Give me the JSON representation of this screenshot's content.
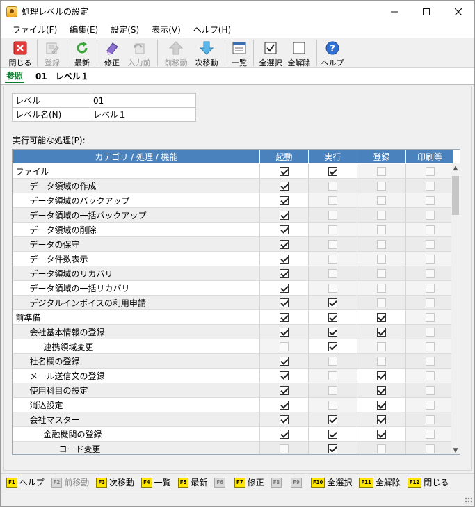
{
  "window": {
    "title": "処理レベルの設定"
  },
  "menu": [
    "ファイル(F)",
    "編集(E)",
    "設定(S)",
    "表示(V)",
    "ヘルプ(H)"
  ],
  "toolbar": [
    {
      "label": "閉じる",
      "icon": "close-icon",
      "disabled": false
    },
    {
      "label": "登録",
      "icon": "register-icon",
      "disabled": true
    },
    {
      "label": "最新",
      "icon": "refresh-icon",
      "disabled": false
    },
    {
      "label": "修正",
      "icon": "edit-icon",
      "disabled": false
    },
    {
      "label": "入力前",
      "icon": "undo-icon",
      "disabled": true
    },
    {
      "label": "前移動",
      "icon": "arrow-up-icon",
      "disabled": true
    },
    {
      "label": "次移動",
      "icon": "arrow-down-icon",
      "disabled": false
    },
    {
      "label": "一覧",
      "icon": "list-icon",
      "disabled": false
    },
    {
      "label": "全選択",
      "icon": "select-all-icon",
      "disabled": false
    },
    {
      "label": "全解除",
      "icon": "deselect-all-icon",
      "disabled": false
    },
    {
      "label": "ヘルプ",
      "icon": "help-icon",
      "disabled": false
    }
  ],
  "tab": {
    "label": "参照",
    "level_title": "01　レベル１"
  },
  "fields": {
    "level_label": "レベル",
    "level_value": "01",
    "level_name_label": "レベル名(N)",
    "level_name_value": "レベル１"
  },
  "section_label": "実行可能な処理(P):",
  "grid": {
    "columns": [
      "カテゴリ / 処理 / 機能",
      "起動",
      "実行",
      "登録",
      "印刷等"
    ],
    "rows": [
      {
        "name": "ファイル",
        "indent": 0,
        "c": [
          1,
          1,
          0,
          0
        ],
        "e": [
          1,
          1,
          0,
          0
        ]
      },
      {
        "name": "データ領域の作成",
        "indent": 1,
        "c": [
          1,
          0,
          0,
          0
        ],
        "e": [
          1,
          0,
          0,
          0
        ]
      },
      {
        "name": "データ領域のバックアップ",
        "indent": 1,
        "c": [
          1,
          0,
          0,
          0
        ],
        "e": [
          1,
          0,
          0,
          0
        ]
      },
      {
        "name": "データ領域の一括バックアップ",
        "indent": 1,
        "c": [
          1,
          0,
          0,
          0
        ],
        "e": [
          1,
          0,
          0,
          0
        ]
      },
      {
        "name": "データ領域の削除",
        "indent": 1,
        "c": [
          1,
          0,
          0,
          0
        ],
        "e": [
          1,
          0,
          0,
          0
        ]
      },
      {
        "name": "データの保守",
        "indent": 1,
        "c": [
          1,
          0,
          0,
          0
        ],
        "e": [
          1,
          0,
          0,
          0
        ]
      },
      {
        "name": "データ件数表示",
        "indent": 1,
        "c": [
          1,
          0,
          0,
          0
        ],
        "e": [
          1,
          0,
          0,
          0
        ]
      },
      {
        "name": "データ領域のリカバリ",
        "indent": 1,
        "c": [
          1,
          0,
          0,
          0
        ],
        "e": [
          1,
          0,
          0,
          0
        ]
      },
      {
        "name": "データ領域の一括リカバリ",
        "indent": 1,
        "c": [
          1,
          0,
          0,
          0
        ],
        "e": [
          1,
          0,
          0,
          0
        ]
      },
      {
        "name": "デジタルインボイスの利用申請",
        "indent": 1,
        "c": [
          1,
          1,
          0,
          0
        ],
        "e": [
          1,
          1,
          0,
          0
        ]
      },
      {
        "name": "前準備",
        "indent": 0,
        "c": [
          1,
          1,
          1,
          0
        ],
        "e": [
          1,
          1,
          1,
          0
        ]
      },
      {
        "name": "会社基本情報の登録",
        "indent": 1,
        "c": [
          1,
          1,
          1,
          0
        ],
        "e": [
          1,
          1,
          1,
          0
        ]
      },
      {
        "name": "連携領域変更",
        "indent": 2,
        "c": [
          0,
          1,
          0,
          0
        ],
        "e": [
          0,
          1,
          0,
          0
        ]
      },
      {
        "name": "社名欄の登録",
        "indent": 1,
        "c": [
          1,
          0,
          0,
          0
        ],
        "e": [
          1,
          0,
          0,
          0
        ]
      },
      {
        "name": "メール送信文の登録",
        "indent": 1,
        "c": [
          1,
          0,
          1,
          0
        ],
        "e": [
          1,
          0,
          1,
          0
        ]
      },
      {
        "name": "使用科目の設定",
        "indent": 1,
        "c": [
          1,
          0,
          1,
          0
        ],
        "e": [
          1,
          0,
          1,
          0
        ]
      },
      {
        "name": "消込設定",
        "indent": 1,
        "c": [
          1,
          0,
          1,
          0
        ],
        "e": [
          1,
          0,
          1,
          0
        ]
      },
      {
        "name": "会社マスター",
        "indent": 1,
        "c": [
          1,
          1,
          1,
          0
        ],
        "e": [
          1,
          1,
          1,
          0
        ]
      },
      {
        "name": "金融機関の登録",
        "indent": 2,
        "c": [
          1,
          1,
          1,
          0
        ],
        "e": [
          1,
          1,
          1,
          0
        ]
      },
      {
        "name": "コード変更",
        "indent": 3,
        "c": [
          0,
          1,
          0,
          0
        ],
        "e": [
          0,
          1,
          0,
          0
        ]
      }
    ]
  },
  "fkeys": [
    {
      "key": "F1",
      "label": "ヘルプ",
      "disabled": false
    },
    {
      "key": "F2",
      "label": "前移動",
      "disabled": true
    },
    {
      "key": "F3",
      "label": "次移動",
      "disabled": false
    },
    {
      "key": "F4",
      "label": "一覧",
      "disabled": false
    },
    {
      "key": "F5",
      "label": "最新",
      "disabled": false
    },
    {
      "key": "F6",
      "label": "",
      "disabled": true
    },
    {
      "key": "F7",
      "label": "修正",
      "disabled": false
    },
    {
      "key": "F8",
      "label": "",
      "disabled": true
    },
    {
      "key": "F9",
      "label": "",
      "disabled": true
    },
    {
      "key": "F10",
      "label": "全選択",
      "disabled": false
    },
    {
      "key": "F11",
      "label": "全解除",
      "disabled": false
    },
    {
      "key": "F12",
      "label": "閉じる",
      "disabled": false
    }
  ]
}
